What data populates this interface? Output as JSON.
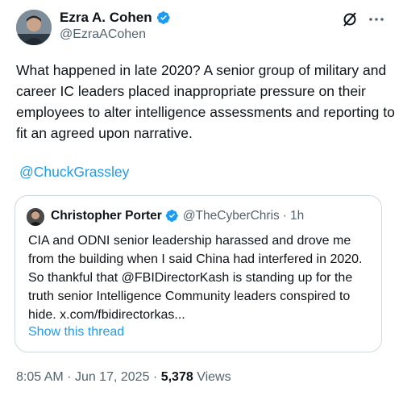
{
  "author": {
    "name": "Ezra A. Cohen",
    "handle": "@EzraACohen"
  },
  "tweet": {
    "text": "What happened in late 2020? A senior group of military and career IC leaders placed inappropriate pressure on their employees to alter intelligence assessments and reporting to fit an agreed upon narrative.",
    "mention": "@ChuckGrassley"
  },
  "quote": {
    "name": "Christopher Porter",
    "handle": "@TheCyberChris",
    "separator": "·",
    "time": "1h",
    "text": "CIA and ODNI senior leadership harassed and drove me from the building when I said China had interfered in 2020. So thankful that @FBIDirectorKash is standing up for the truth senior Intelligence Community leaders conspired to hide. x.com/fbidirectorkas...",
    "show_thread": "Show this thread"
  },
  "footer": {
    "time": "8:05 AM",
    "separator": "·",
    "date": "Jun 17, 2025",
    "views_count": "5,378",
    "views_label": "Views"
  },
  "colors": {
    "accent": "#1d9bf0",
    "secondary_text": "#536471",
    "border": "#cfd9de"
  },
  "icons": {
    "verified": "verified-badge-icon",
    "grok": "grok-icon",
    "more": "more-horizontal-icon"
  }
}
